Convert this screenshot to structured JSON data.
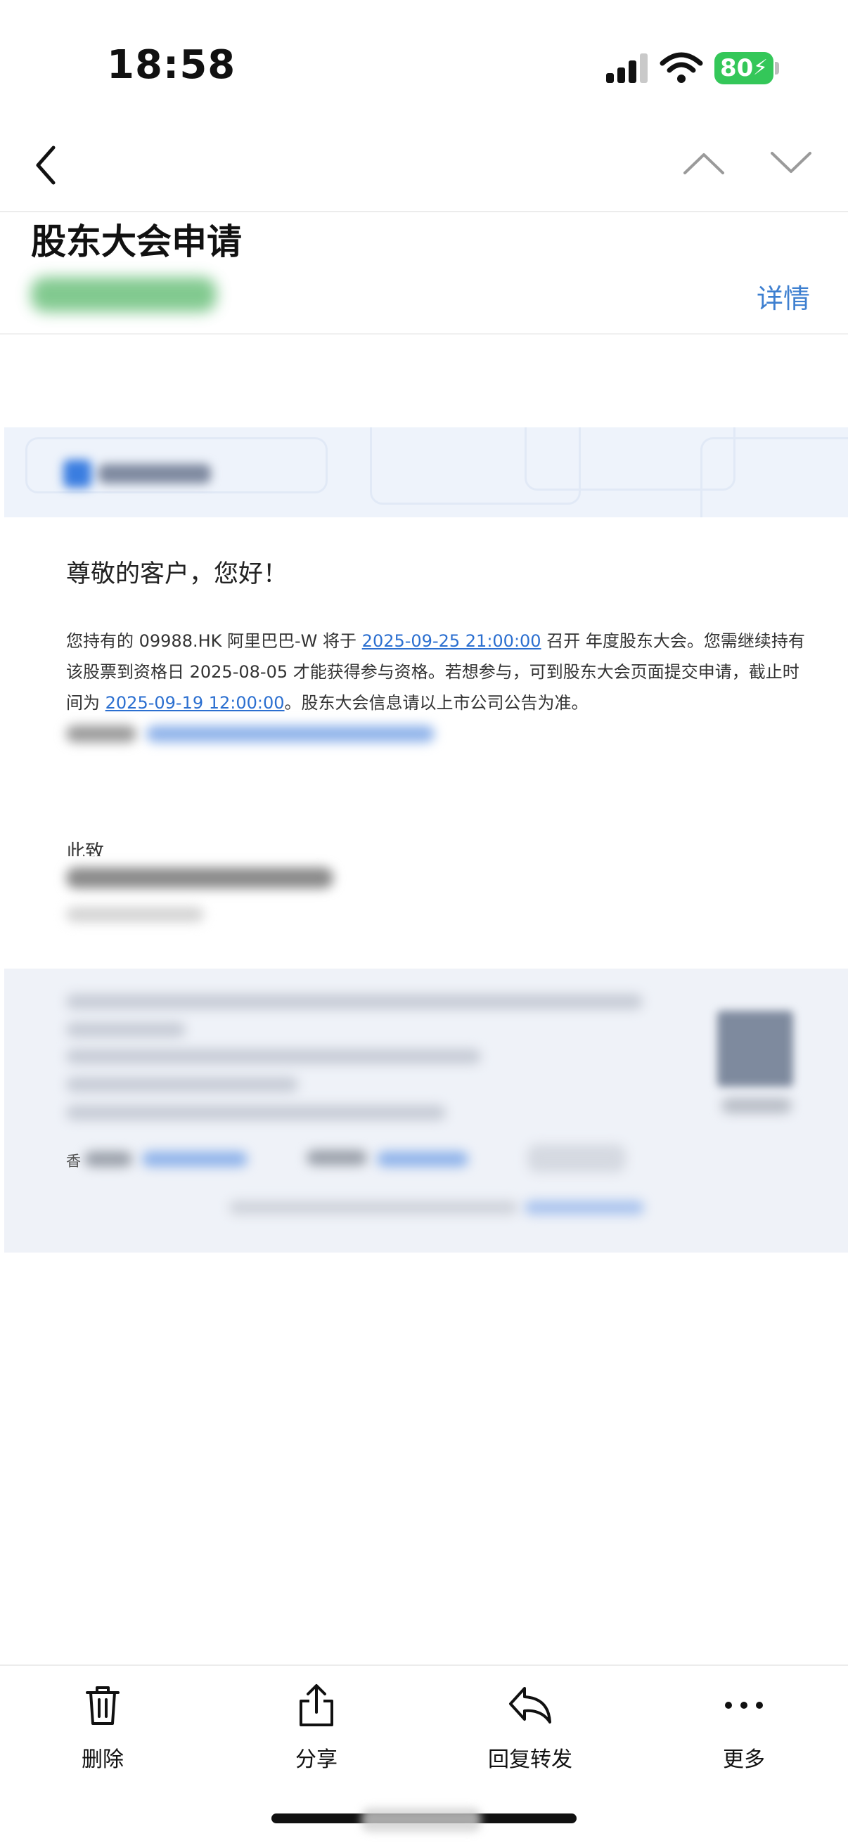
{
  "status_bar": {
    "time": "18:58",
    "battery_level": "80",
    "icons": [
      "cellular-signal-icon",
      "wifi-icon",
      "battery-charging-icon"
    ]
  },
  "nav": {
    "icons": [
      "chevron-left-icon",
      "chevron-up-icon",
      "chevron-down-icon"
    ]
  },
  "header": {
    "subject": "股东大会申请",
    "detail_label": "详情"
  },
  "mail": {
    "greeting": "尊敬的客户，您好！",
    "body": {
      "part1": "您持有的 09988.HK 阿里巴巴-W 将于 ",
      "meeting_time": "2025-09-25 21:00:00",
      "part2": " 召开 年度股东大会。您需继续持有该股票到资格日 2025-08-05 才能获得参与资格。若想参与，可到股东大会页面提交申请，截止时间为 ",
      "deadline": "2025-09-19 12:00:00",
      "part3": "。股东大会信息请以上市公司公告为准。"
    },
    "closing": "此致",
    "footer_visible_char": "香"
  },
  "tab_bar": {
    "items": [
      {
        "label": "删除",
        "icon": "trash-icon"
      },
      {
        "label": "分享",
        "icon": "share-icon"
      },
      {
        "label": "回复转发",
        "icon": "reply-icon"
      },
      {
        "label": "更多",
        "icon": "more-icon"
      }
    ]
  },
  "colors": {
    "link_blue": "#2b6fd0",
    "detail_blue": "#3d7fd0",
    "battery_green": "#34c759",
    "banner_bg": "#eef3fb",
    "footer_bg": "#eff2f8"
  }
}
